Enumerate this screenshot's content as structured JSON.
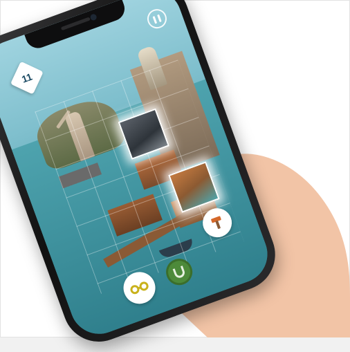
{
  "game": {
    "level_number": "11"
  },
  "icons": {
    "level": "level-badge-icon",
    "pause": "pause-icon",
    "goggles": "goggles-icon",
    "magnet": "magnet-icon",
    "hammer": "hammer-icon"
  },
  "colors": {
    "sea": "#4ea3ae",
    "magnet_button": "#4d8a3a",
    "hand_skin": "#f2c4a6",
    "nail_polish": "#c8283a"
  }
}
